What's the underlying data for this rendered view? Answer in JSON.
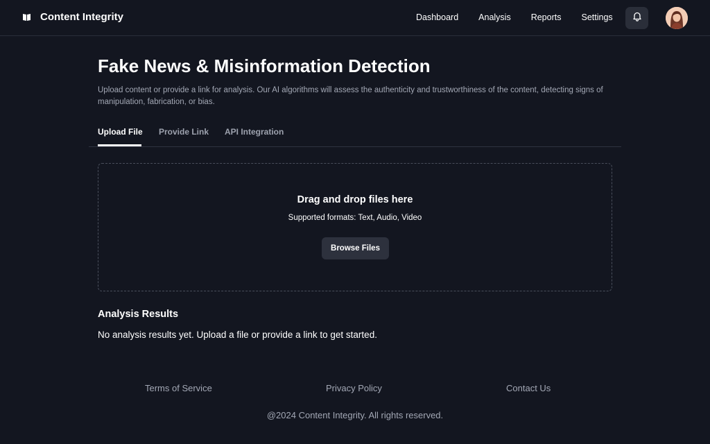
{
  "header": {
    "brand_name": "Content Integrity",
    "brand_icon": "book-icon",
    "nav": [
      {
        "label": "Dashboard"
      },
      {
        "label": "Analysis"
      },
      {
        "label": "Reports"
      },
      {
        "label": "Settings"
      }
    ],
    "notification_icon": "bell-icon",
    "avatar": "user-avatar"
  },
  "main": {
    "title": "Fake News & Misinformation Detection",
    "description": "Upload content or provide a link for analysis. Our AI algorithms will assess the authenticity and trustworthiness of the content, detecting signs of manipulation, fabrication, or bias.",
    "tabs": [
      {
        "label": "Upload File",
        "active": true
      },
      {
        "label": "Provide Link",
        "active": false
      },
      {
        "label": "API Integration",
        "active": false
      }
    ],
    "dropzone": {
      "title": "Drag and drop files here",
      "subtitle": "Supported formats: Text, Audio, Video",
      "button_label": "Browse Files"
    },
    "results": {
      "title": "Analysis Results",
      "empty_message": "No analysis results yet. Upload a file or provide a link to get started."
    }
  },
  "footer": {
    "links": [
      {
        "label": "Terms of Service"
      },
      {
        "label": "Privacy Policy"
      },
      {
        "label": "Contact Us"
      }
    ],
    "copyright": "@2024 Content Integrity. All rights reserved."
  },
  "colors": {
    "background": "#131620",
    "text_primary": "#ffffff",
    "text_muted": "#a3a8b5",
    "button_bg": "#2d313d",
    "border": "#2a2e3a"
  }
}
